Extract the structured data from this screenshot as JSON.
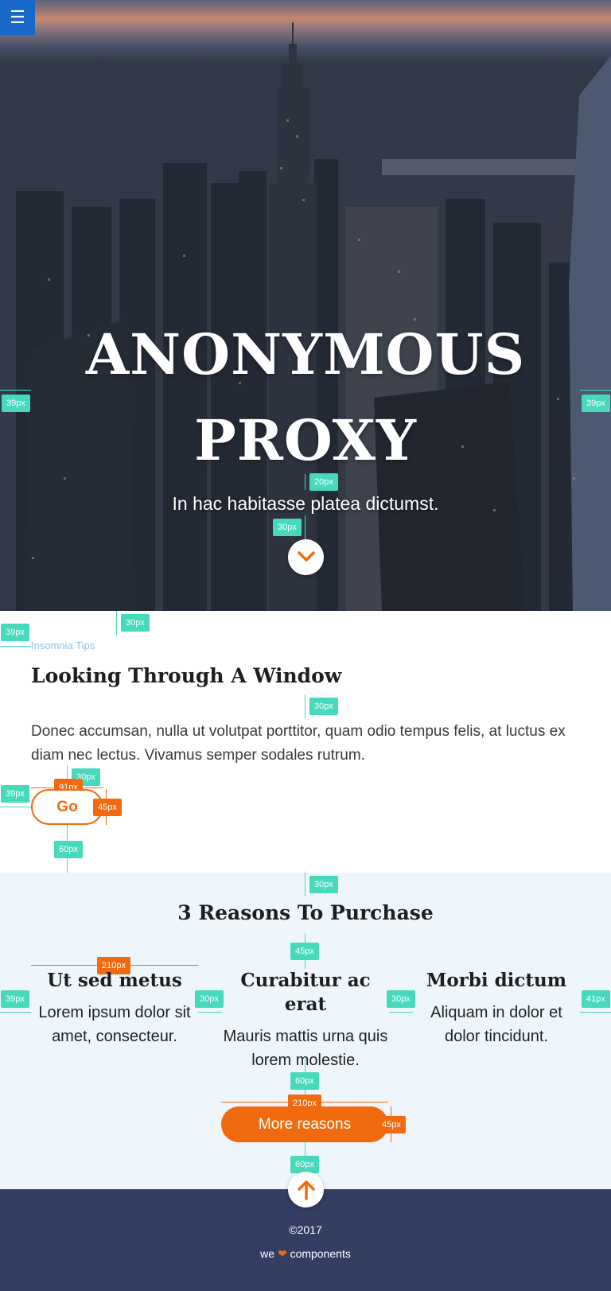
{
  "nav": {
    "menu_icon": "☰"
  },
  "hero": {
    "title_line1": "ANONYMOUS",
    "title_line2": "PROXY",
    "subtitle": "In hac habitasse platea dictumst.",
    "scroll_icon": "chevron-down-icon"
  },
  "article": {
    "eyebrow": "Insomnia Tips",
    "title": "Looking Through A Window",
    "text": "Donec accumsan, nulla ut volutpat porttitor, quam odio tempus felis, at luctus ex diam nec lectus. Vivamus semper sodales rutrum.",
    "button_label": "Go"
  },
  "reasons": {
    "title": "3 Reasons To Purchase",
    "items": [
      {
        "heading": "Ut sed metus",
        "text": "Lorem ipsum dolor sit amet, consecteur."
      },
      {
        "heading": "Curabitur ac erat",
        "text": "Mauris mattis urna quis lorem molestie."
      },
      {
        "heading": "Morbi dictum",
        "text": "Aliquam in dolor et dolor tincidunt."
      }
    ],
    "button_label": "More reasons"
  },
  "footer": {
    "copyright": "©2017",
    "made_prefix": "we",
    "heart": "❤",
    "made_suffix": "components",
    "scroll_top_icon": "arrow-up-icon"
  },
  "annotations": {
    "a39": "39px",
    "a20": "20px",
    "a30": "30px",
    "a91": "91px",
    "a45": "45px",
    "a60": "60px",
    "a210": "210px",
    "a41": "41px"
  },
  "colors": {
    "accent": "#f26a0f",
    "guide": "#46d9bb",
    "menu": "#1768c8",
    "section_bg": "#eef6fc",
    "footer_bg": "#343e63",
    "eyebrow": "#8ec1e6"
  }
}
